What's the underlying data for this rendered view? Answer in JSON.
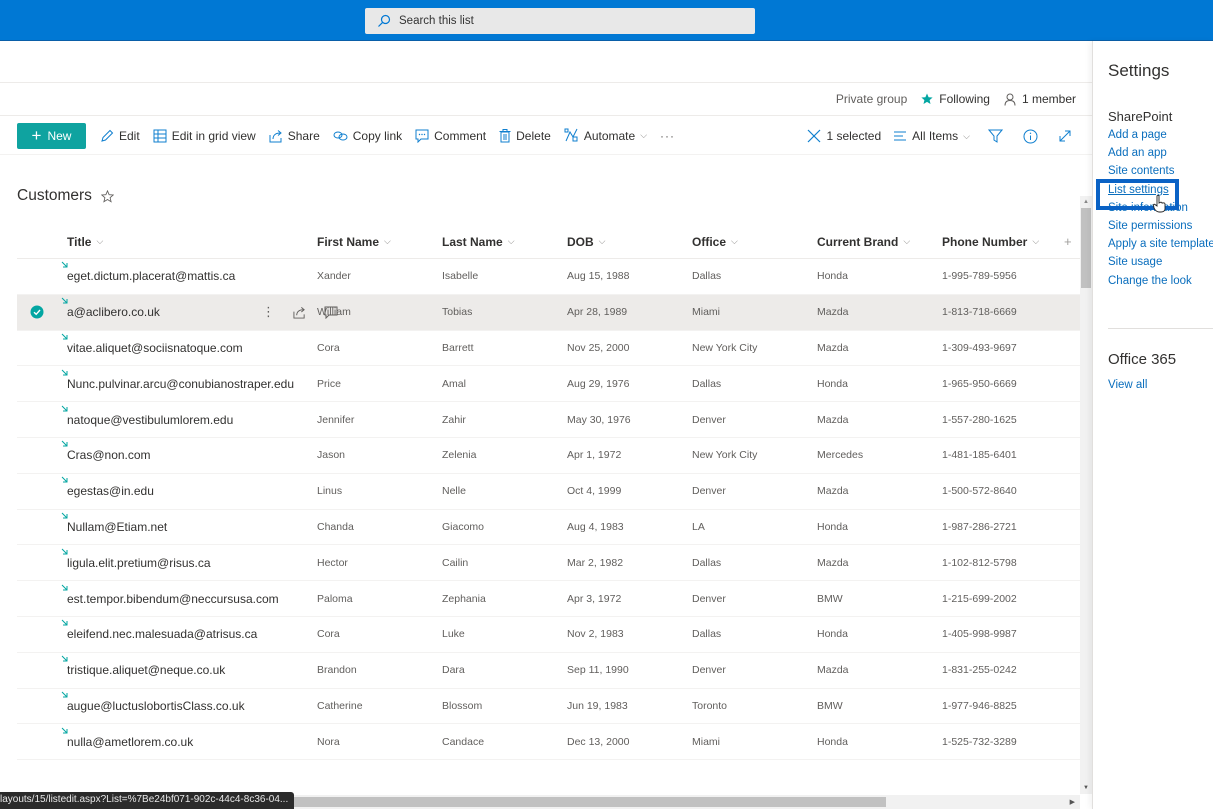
{
  "header": {
    "search_placeholder": "Search this list",
    "brand_color": "#0078d4"
  },
  "group_bar": {
    "privacy": "Private group",
    "following": "Following",
    "members": "1 member"
  },
  "command_bar": {
    "new": "New",
    "edit": "Edit",
    "edit_grid": "Edit in grid view",
    "share": "Share",
    "copy_link": "Copy link",
    "comment": "Comment",
    "delete": "Delete",
    "automate": "Automate",
    "more": "···",
    "selected_count": "1 selected",
    "view": "All Items",
    "accent_color": "#03a6a2"
  },
  "list": {
    "title": "Customers",
    "columns": [
      "Title",
      "First Name",
      "Last Name",
      "DOB",
      "Office",
      "Current Brand",
      "Phone Number"
    ],
    "add_column": "+",
    "rows": [
      {
        "title": "eget.dictum.placerat@mattis.ca",
        "first": "Xander",
        "last": "Isabelle",
        "dob": "Aug 15, 1988",
        "office": "Dallas",
        "brand": "Honda",
        "phone": "1-995-789-5956",
        "selected": false
      },
      {
        "title": "a@aclibero.co.uk",
        "first": "William",
        "last": "Tobias",
        "dob": "Apr 28, 1989",
        "office": "Miami",
        "brand": "Mazda",
        "phone": "1-813-718-6669",
        "selected": true
      },
      {
        "title": "vitae.aliquet@sociisnatoque.com",
        "first": "Cora",
        "last": "Barrett",
        "dob": "Nov 25, 2000",
        "office": "New York City",
        "brand": "Mazda",
        "phone": "1-309-493-9697",
        "selected": false
      },
      {
        "title": "Nunc.pulvinar.arcu@conubianostraper.edu",
        "first": "Price",
        "last": "Amal",
        "dob": "Aug 29, 1976",
        "office": "Dallas",
        "brand": "Honda",
        "phone": "1-965-950-6669",
        "selected": false
      },
      {
        "title": "natoque@vestibulumlorem.edu",
        "first": "Jennifer",
        "last": "Zahir",
        "dob": "May 30, 1976",
        "office": "Denver",
        "brand": "Mazda",
        "phone": "1-557-280-1625",
        "selected": false
      },
      {
        "title": "Cras@non.com",
        "first": "Jason",
        "last": "Zelenia",
        "dob": "Apr 1, 1972",
        "office": "New York City",
        "brand": "Mercedes",
        "phone": "1-481-185-6401",
        "selected": false
      },
      {
        "title": "egestas@in.edu",
        "first": "Linus",
        "last": "Nelle",
        "dob": "Oct 4, 1999",
        "office": "Denver",
        "brand": "Mazda",
        "phone": "1-500-572-8640",
        "selected": false
      },
      {
        "title": "Nullam@Etiam.net",
        "first": "Chanda",
        "last": "Giacomo",
        "dob": "Aug 4, 1983",
        "office": "LA",
        "brand": "Honda",
        "phone": "1-987-286-2721",
        "selected": false
      },
      {
        "title": "ligula.elit.pretium@risus.ca",
        "first": "Hector",
        "last": "Cailin",
        "dob": "Mar 2, 1982",
        "office": "Dallas",
        "brand": "Mazda",
        "phone": "1-102-812-5798",
        "selected": false
      },
      {
        "title": "est.tempor.bibendum@neccursusa.com",
        "first": "Paloma",
        "last": "Zephania",
        "dob": "Apr 3, 1972",
        "office": "Denver",
        "brand": "BMW",
        "phone": "1-215-699-2002",
        "selected": false
      },
      {
        "title": "eleifend.nec.malesuada@atrisus.ca",
        "first": "Cora",
        "last": "Luke",
        "dob": "Nov 2, 1983",
        "office": "Dallas",
        "brand": "Honda",
        "phone": "1-405-998-9987",
        "selected": false
      },
      {
        "title": "tristique.aliquet@neque.co.uk",
        "first": "Brandon",
        "last": "Dara",
        "dob": "Sep 11, 1990",
        "office": "Denver",
        "brand": "Mazda",
        "phone": "1-831-255-0242",
        "selected": false
      },
      {
        "title": "augue@luctuslobortisClass.co.uk",
        "first": "Catherine",
        "last": "Blossom",
        "dob": "Jun 19, 1983",
        "office": "Toronto",
        "brand": "BMW",
        "phone": "1-977-946-8825",
        "selected": false
      },
      {
        "title": "nulla@ametlorem.co.uk",
        "first": "Nora",
        "last": "Candace",
        "dob": "Dec 13, 2000",
        "office": "Miami",
        "brand": "Honda",
        "phone": "1-525-732-3289",
        "selected": false
      }
    ]
  },
  "settings_panel": {
    "title": "Settings",
    "sharepoint": {
      "heading": "SharePoint",
      "links": [
        "Add a page",
        "Add an app",
        "Site contents",
        "List settings",
        "Site information",
        "Site permissions",
        "Apply a site template",
        "Site usage",
        "Change the look"
      ],
      "highlighted": "List settings"
    },
    "office365": {
      "heading": "Office 365",
      "links": [
        "View all"
      ]
    }
  },
  "status_bar": {
    "url": "layouts/15/listedit.aspx?List=%7Be24bf071-902c-44c4-8c36-04..."
  }
}
